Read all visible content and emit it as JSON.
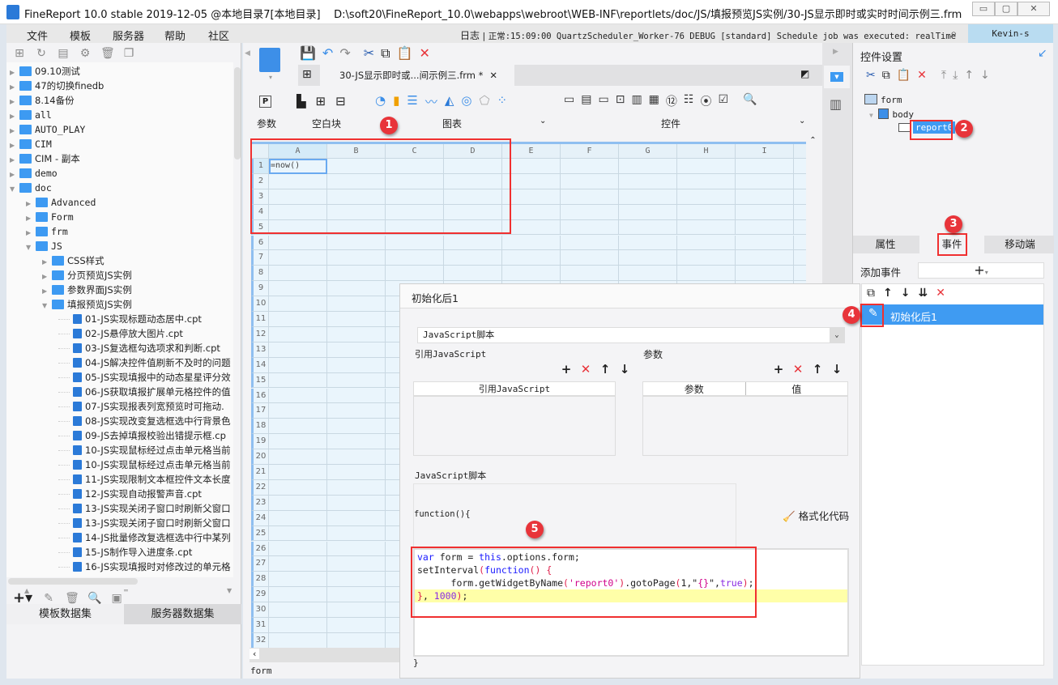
{
  "window": {
    "title": "FineReport 10.0 stable 2019-12-05 @本地目录7[本地目录]",
    "path": "D:\\soft20\\FineReport_10.0\\webapps\\webroot\\WEB-INF\\reportlets/doc/JS/填报预览JS实例/30-JS显示即时或实时时间示例三.frm",
    "controls": [
      "▭",
      "▢",
      "✕"
    ]
  },
  "menu": {
    "items": [
      "文件",
      "模板",
      "服务器",
      "帮助",
      "社区"
    ],
    "log_label": "日志",
    "log_text": "正常:15:09:00 QuartzScheduler_Worker-76 DEBUG [standard] Schedule job was executed: realTime",
    "user": "Kevin-s"
  },
  "tree": {
    "items": [
      {
        "label": "09.10测试",
        "level": 0,
        "type": "folder",
        "expanded": false
      },
      {
        "label": "47的切换finedb",
        "level": 0,
        "type": "folder",
        "expanded": false
      },
      {
        "label": "8.14备份",
        "level": 0,
        "type": "folder",
        "expanded": false
      },
      {
        "label": "all",
        "level": 0,
        "type": "folder",
        "expanded": false
      },
      {
        "label": "AUTO_PLAY",
        "level": 0,
        "type": "folder",
        "expanded": false
      },
      {
        "label": "CIM",
        "level": 0,
        "type": "folder",
        "expanded": false
      },
      {
        "label": "CIM - 副本",
        "level": 0,
        "type": "folder",
        "expanded": false
      },
      {
        "label": "demo",
        "level": 0,
        "type": "folder",
        "expanded": false
      },
      {
        "label": "doc",
        "level": 0,
        "type": "folder",
        "expanded": true
      },
      {
        "label": "Advanced",
        "level": 1,
        "type": "folder",
        "expanded": false
      },
      {
        "label": "Form",
        "level": 1,
        "type": "folder",
        "expanded": false
      },
      {
        "label": "frm",
        "level": 1,
        "type": "folder",
        "expanded": false
      },
      {
        "label": "JS",
        "level": 1,
        "type": "folder",
        "expanded": true
      },
      {
        "label": "CSS样式",
        "level": 2,
        "type": "folder",
        "expanded": false
      },
      {
        "label": "分页预览JS实例",
        "level": 2,
        "type": "folder",
        "expanded": false
      },
      {
        "label": "参数界面JS实例",
        "level": 2,
        "type": "folder",
        "expanded": false
      },
      {
        "label": "填报预览JS实例",
        "level": 2,
        "type": "folder",
        "expanded": true
      },
      {
        "label": "01-JS实现标题动态居中.cpt",
        "level": 3,
        "type": "file"
      },
      {
        "label": "02-JS悬停放大图片.cpt",
        "level": 3,
        "type": "file"
      },
      {
        "label": "03-JS复选框勾选项求和判断.cpt",
        "level": 3,
        "type": "file"
      },
      {
        "label": "04-JS解决控件值刷新不及时的问题",
        "level": 3,
        "type": "file"
      },
      {
        "label": "05-JS实现填报中的动态星星评分效",
        "level": 3,
        "type": "file"
      },
      {
        "label": "06-JS获取填报扩展单元格控件的值",
        "level": 3,
        "type": "file"
      },
      {
        "label": "07-JS实现报表列宽预览时可拖动.",
        "level": 3,
        "type": "file"
      },
      {
        "label": "08-JS实现改变复选框选中行背景色",
        "level": 3,
        "type": "file"
      },
      {
        "label": "09-JS去掉填报校验出错提示框.cp",
        "level": 3,
        "type": "file"
      },
      {
        "label": "10-JS实现鼠标经过点击单元格当前",
        "level": 3,
        "type": "file"
      },
      {
        "label": "10-JS实现鼠标经过点击单元格当前",
        "level": 3,
        "type": "file"
      },
      {
        "label": "11-JS实现限制文本框控件文本长度",
        "level": 3,
        "type": "file"
      },
      {
        "label": "12-JS实现自动报警声音.cpt",
        "level": 3,
        "type": "file"
      },
      {
        "label": "13-JS实现关闭子窗口时刷新父窗口",
        "level": 3,
        "type": "file"
      },
      {
        "label": "13-JS实现关闭子窗口时刷新父窗口",
        "level": 3,
        "type": "file"
      },
      {
        "label": "14-JS批量修改复选框选中行中某列",
        "level": 3,
        "type": "file"
      },
      {
        "label": "15-JS制作导入进度条.cpt",
        "level": 3,
        "type": "file"
      },
      {
        "label": "16-JS实现填报时对修改过的单元格",
        "level": 3,
        "type": "file"
      }
    ]
  },
  "dataset_tabs": [
    "模板数据集",
    "服务器数据集"
  ],
  "editor": {
    "tab_label": "30-JS显示即时或...间示例三.frm *",
    "ribbon": {
      "groups": [
        "参数",
        "空白块",
        "图表",
        "控件"
      ]
    },
    "grid": {
      "columns": [
        "A",
        "B",
        "C",
        "D",
        "E",
        "F",
        "G",
        "H",
        "I"
      ],
      "row_count": 32,
      "cell_a1": "=now()"
    },
    "footer": "form"
  },
  "widget_panel": {
    "title": "控件设置",
    "tree": [
      "form",
      "body",
      "report0"
    ],
    "tabs": [
      "属性",
      "事件",
      "移动端"
    ],
    "active_tab": "事件",
    "add_event_label": "添加事件",
    "events": [
      "初始化后1"
    ]
  },
  "dialog": {
    "title": "初始化后1",
    "type_select": "JavaScript脚本",
    "ref_section": "引用JavaScript",
    "ref_column": "引用JavaScript",
    "param_section": "参数",
    "param_columns": [
      "参数",
      "值"
    ],
    "script_section": "JavaScript脚本",
    "function_open": "function(){",
    "format_label": "格式化代码",
    "function_close": "}",
    "code": [
      "var form = this.options.form;",
      "setInterval(function() {",
      "      form.getWidgetByName('report0').gotoPage(1,\"{}\",true);",
      "}, 1000);"
    ]
  },
  "annotations": [
    "1",
    "2",
    "3",
    "4",
    "5"
  ],
  "colors": {
    "accent": "#3d9af2",
    "annotation": "#e8343a",
    "selection": "#3f9bf2"
  }
}
